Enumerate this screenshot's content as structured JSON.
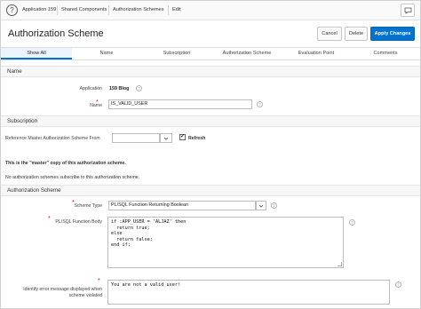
{
  "breadcrumb": {
    "items": [
      "Application 159",
      "Shared Components",
      "Authorization Schemes",
      "Edit"
    ]
  },
  "header": {
    "title": "Authorization Scheme",
    "cancel_label": "Cancel",
    "delete_label": "Delete",
    "apply_label": "Apply Changes"
  },
  "tabs": [
    "Show All",
    "Name",
    "Subscription",
    "Authorization Scheme",
    "Evaluation Point",
    "Comments"
  ],
  "name_region": {
    "title": "Name",
    "application_label": "Application",
    "application_value": "159 Blog",
    "name_label": "Name",
    "name_value": "IS_VALID_USER"
  },
  "subscription_region": {
    "title": "Subscription",
    "reference_label": "Reference Master Authorization Scheme From",
    "reference_value": "",
    "refresh_label": "Refresh",
    "refresh_checked": true,
    "master_note": "This is the \"master\" copy of this authorization scheme.",
    "no_subscribers_note": "No authorization schemes subscribe to this authorization scheme."
  },
  "auth_region": {
    "title": "Authorization Scheme",
    "scheme_type_label": "Scheme Type",
    "scheme_type_value": "PL/SQL Function Returning Boolean",
    "function_body_label": "PL/SQL Function Body",
    "function_body_value": "if :APP_USER = 'ALJAZ' then\n  return true;\nelse\n  return false;\nend if;",
    "error_label_line1": "Identify error message displayed when",
    "error_label_line2": "scheme violated",
    "error_message_value": "You are not a valid user!"
  },
  "icons": {
    "app": "app-icon",
    "chat": "chat-icon",
    "help": "help-icon",
    "dropdown": "chevron-down-icon"
  },
  "colors": {
    "accent": "#0572ce",
    "required": "#dd0000"
  }
}
